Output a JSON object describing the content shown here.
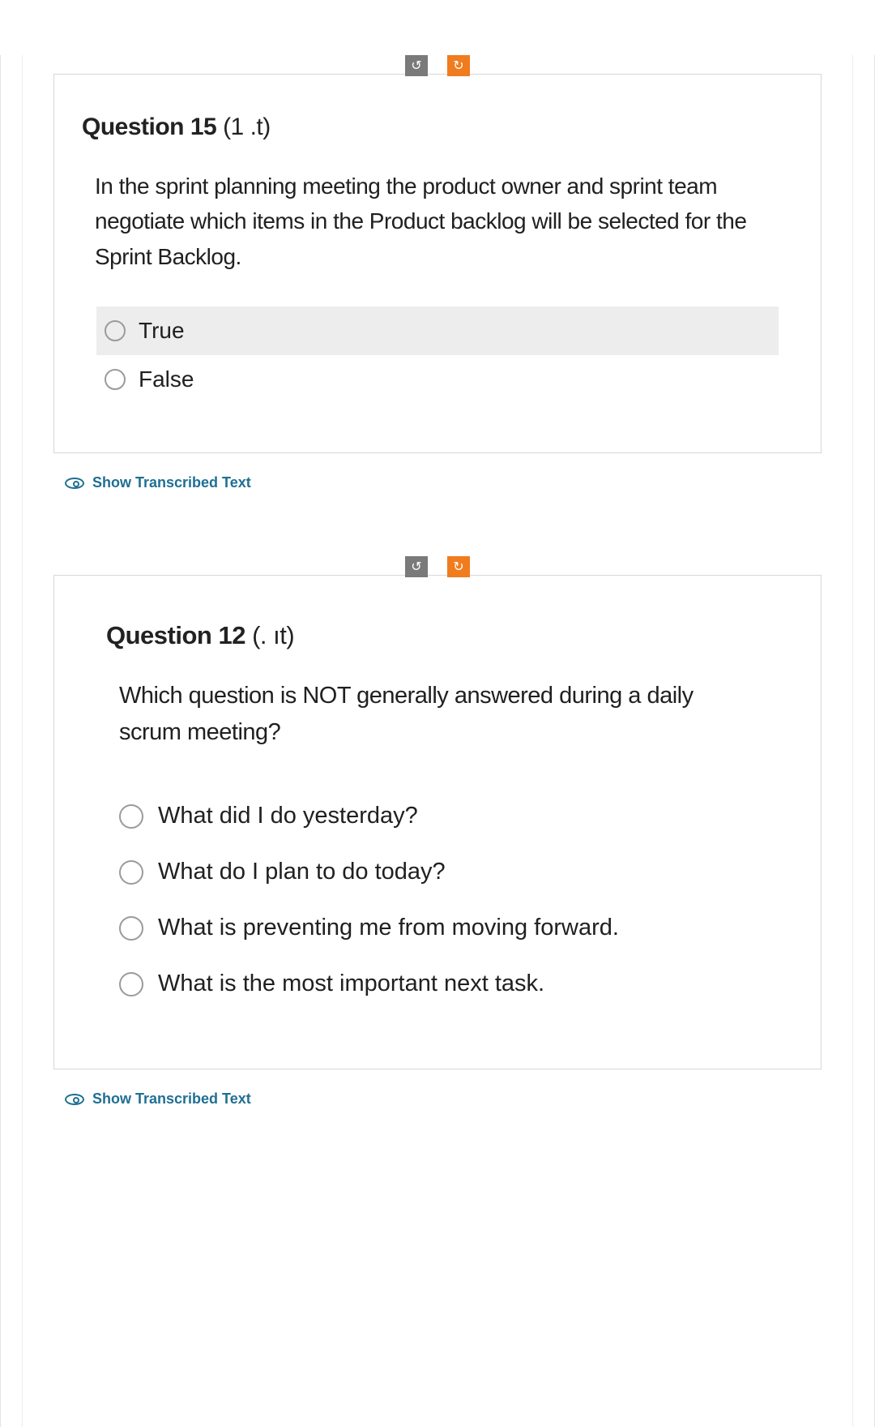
{
  "links": {
    "show_transcribed": "Show Transcribed Text"
  },
  "icons": {
    "ccw": "↺",
    "cw": "↻"
  },
  "q1": {
    "title": "Question 15",
    "title_suffix": "(1       .t)",
    "body": "In the sprint planning meeting the product owner and sprint team negotiate which items in the Product backlog will be selected for the Sprint Backlog.",
    "options": [
      "True",
      "False"
    ]
  },
  "q2": {
    "title": "Question 12",
    "title_suffix": "(.       ıt)",
    "body": "Which question is NOT generally answered during a daily scrum meeting?",
    "options": [
      "What did I do yesterday?",
      "What do I plan to do today?",
      "What is preventing me from moving forward.",
      "What is the most important next task."
    ]
  }
}
